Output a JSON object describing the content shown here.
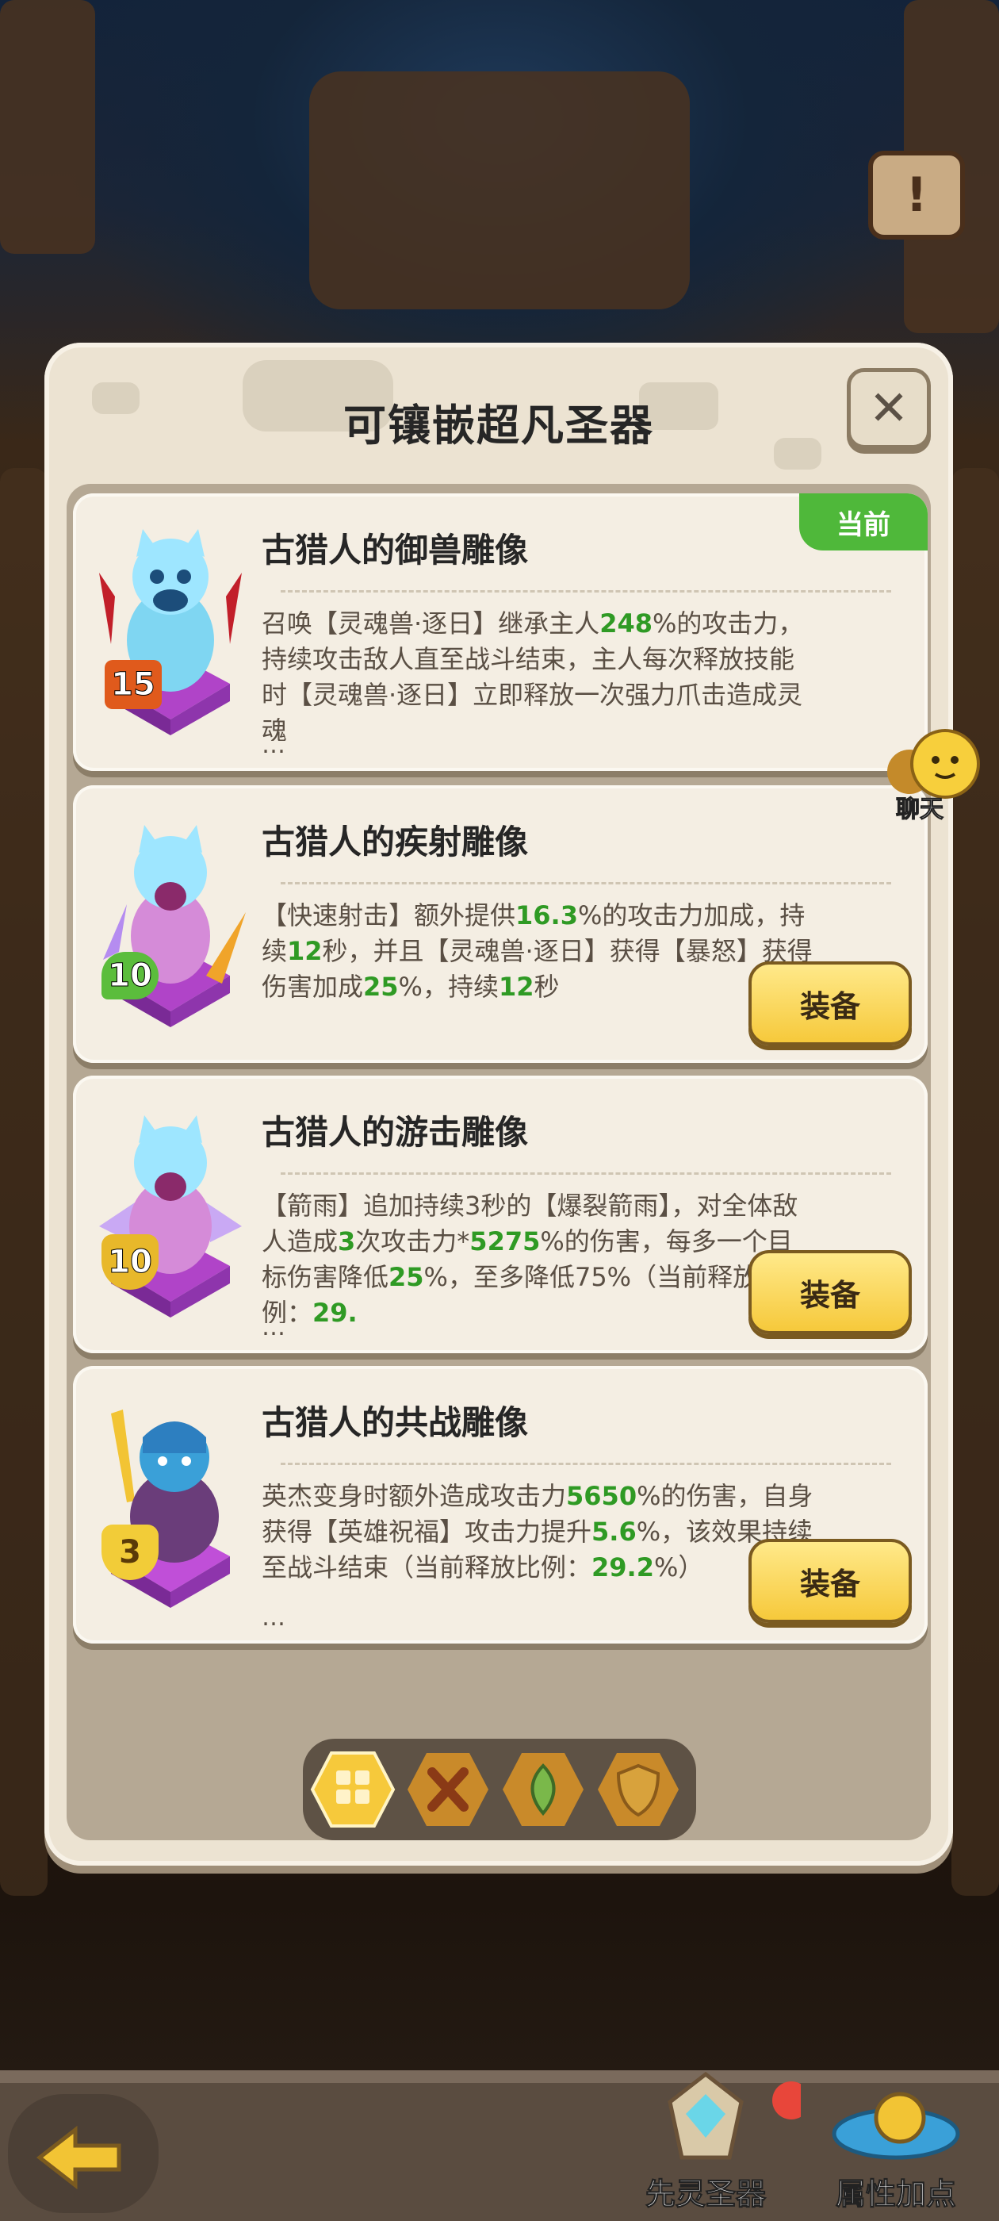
{
  "modal": {
    "title": "可镶嵌超凡圣器",
    "close_symbol": "✕"
  },
  "cards": [
    {
      "title": "古猎人的御兽雕像",
      "level": "15",
      "badge": "当前",
      "desc_parts": [
        "召唤【灵魂兽·逐日】继承主人",
        "248",
        "%的攻击力，持续攻击敌人直至战斗结束，主人每次释放技能时【灵魂兽·逐日】立即释放一次强力爪击造成灵魂"
      ],
      "ellipsis": "…"
    },
    {
      "title": "古猎人的疾射雕像",
      "level": "10",
      "button": "装备",
      "desc_parts": [
        "【快速射击】额外提供",
        "16.3",
        "%的攻击力加成，持续",
        "12",
        "秒，并且【灵魂兽·逐日】获得【暴怒】获得伤害加成",
        "25",
        "%，持续",
        "12",
        "秒"
      ]
    },
    {
      "title": "古猎人的游击雕像",
      "level": "10",
      "button": "装备",
      "desc_parts": [
        "【箭雨】追加持续3秒的【爆裂箭雨】，对全体敌人造成",
        "3",
        "次攻击力*",
        "5275",
        "%的伤害，每多一个目标伤害降低",
        "25",
        "%，至多降低75%（当前释放比例：",
        "29.",
        ""
      ],
      "ellipsis": "…"
    },
    {
      "title": "古猎人的共战雕像",
      "level": "3",
      "button": "装备",
      "desc_parts": [
        "英杰变身时额外造成攻击力",
        "5650",
        "%的伤害，自身获得【英雄祝福】攻击力提升",
        "5.6",
        "%，该效果持续至战斗结束（当前释放比例：",
        "29.2",
        "%）"
      ],
      "ellipsis": "…"
    }
  ],
  "tabs": [
    "grid-filter",
    "attack-filter",
    "leaf-filter",
    "shield-filter"
  ],
  "chat": {
    "label": "聊天"
  },
  "bottom": {
    "item1": "先灵圣器",
    "item2": "属性加点"
  },
  "colors": {
    "highlight_green": "#2f9a24",
    "badge_green": "#4fb83a",
    "button_yellow": "#f6c93b"
  }
}
